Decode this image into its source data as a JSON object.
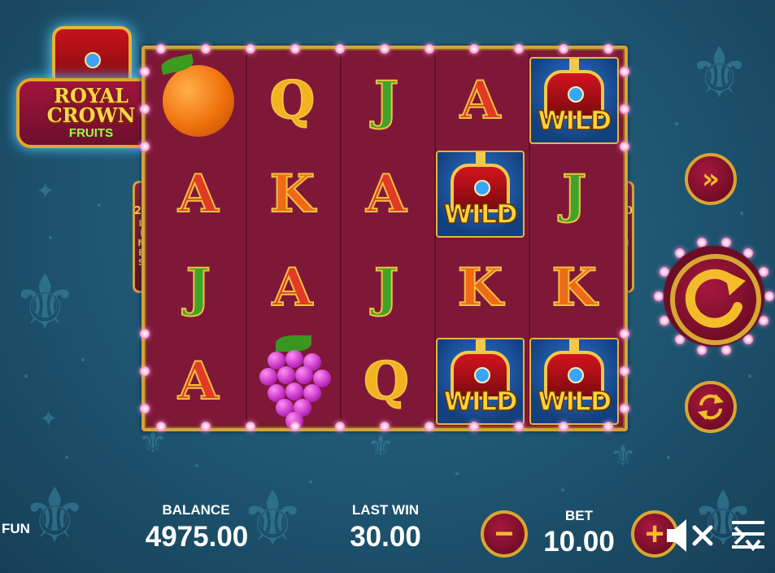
{
  "logo": {
    "line1": "ROYAL",
    "line2": "CROWN",
    "line3": "FRUITS"
  },
  "lines_indicator": {
    "count": "20",
    "word": [
      "L",
      "I",
      "N",
      "E",
      "S"
    ]
  },
  "reels": [
    [
      "orange",
      "A",
      "J",
      "A"
    ],
    [
      "Q",
      "K",
      "A",
      "grapes"
    ],
    [
      "J",
      "A",
      "J",
      "Q"
    ],
    [
      "A",
      "WILD",
      "K",
      "WILD"
    ],
    [
      "WILD",
      "J",
      "K",
      "WILD"
    ]
  ],
  "wild_text": "WILD",
  "controls": {
    "turbo_icon": "double-chevron-right-icon",
    "spin_icon": "spin-arrow-icon",
    "autoplay_icon": "autoplay-cycle-icon",
    "sound_icon": "speaker-muted-icon",
    "menu_icon": "menu-sliders-icon"
  },
  "footer": {
    "mode": "FUN",
    "balance_label": "BALANCE",
    "balance_value": "4975.00",
    "last_win_label": "LAST WIN",
    "last_win_value": "30.00",
    "bet_label": "BET",
    "bet_value": "10.00",
    "bet_minus": "−",
    "bet_plus": "+"
  },
  "colors": {
    "background": "#1e5470",
    "reel_bg": "#7f1838",
    "gold": "#d6a23a",
    "button_red": "#8a1232"
  }
}
